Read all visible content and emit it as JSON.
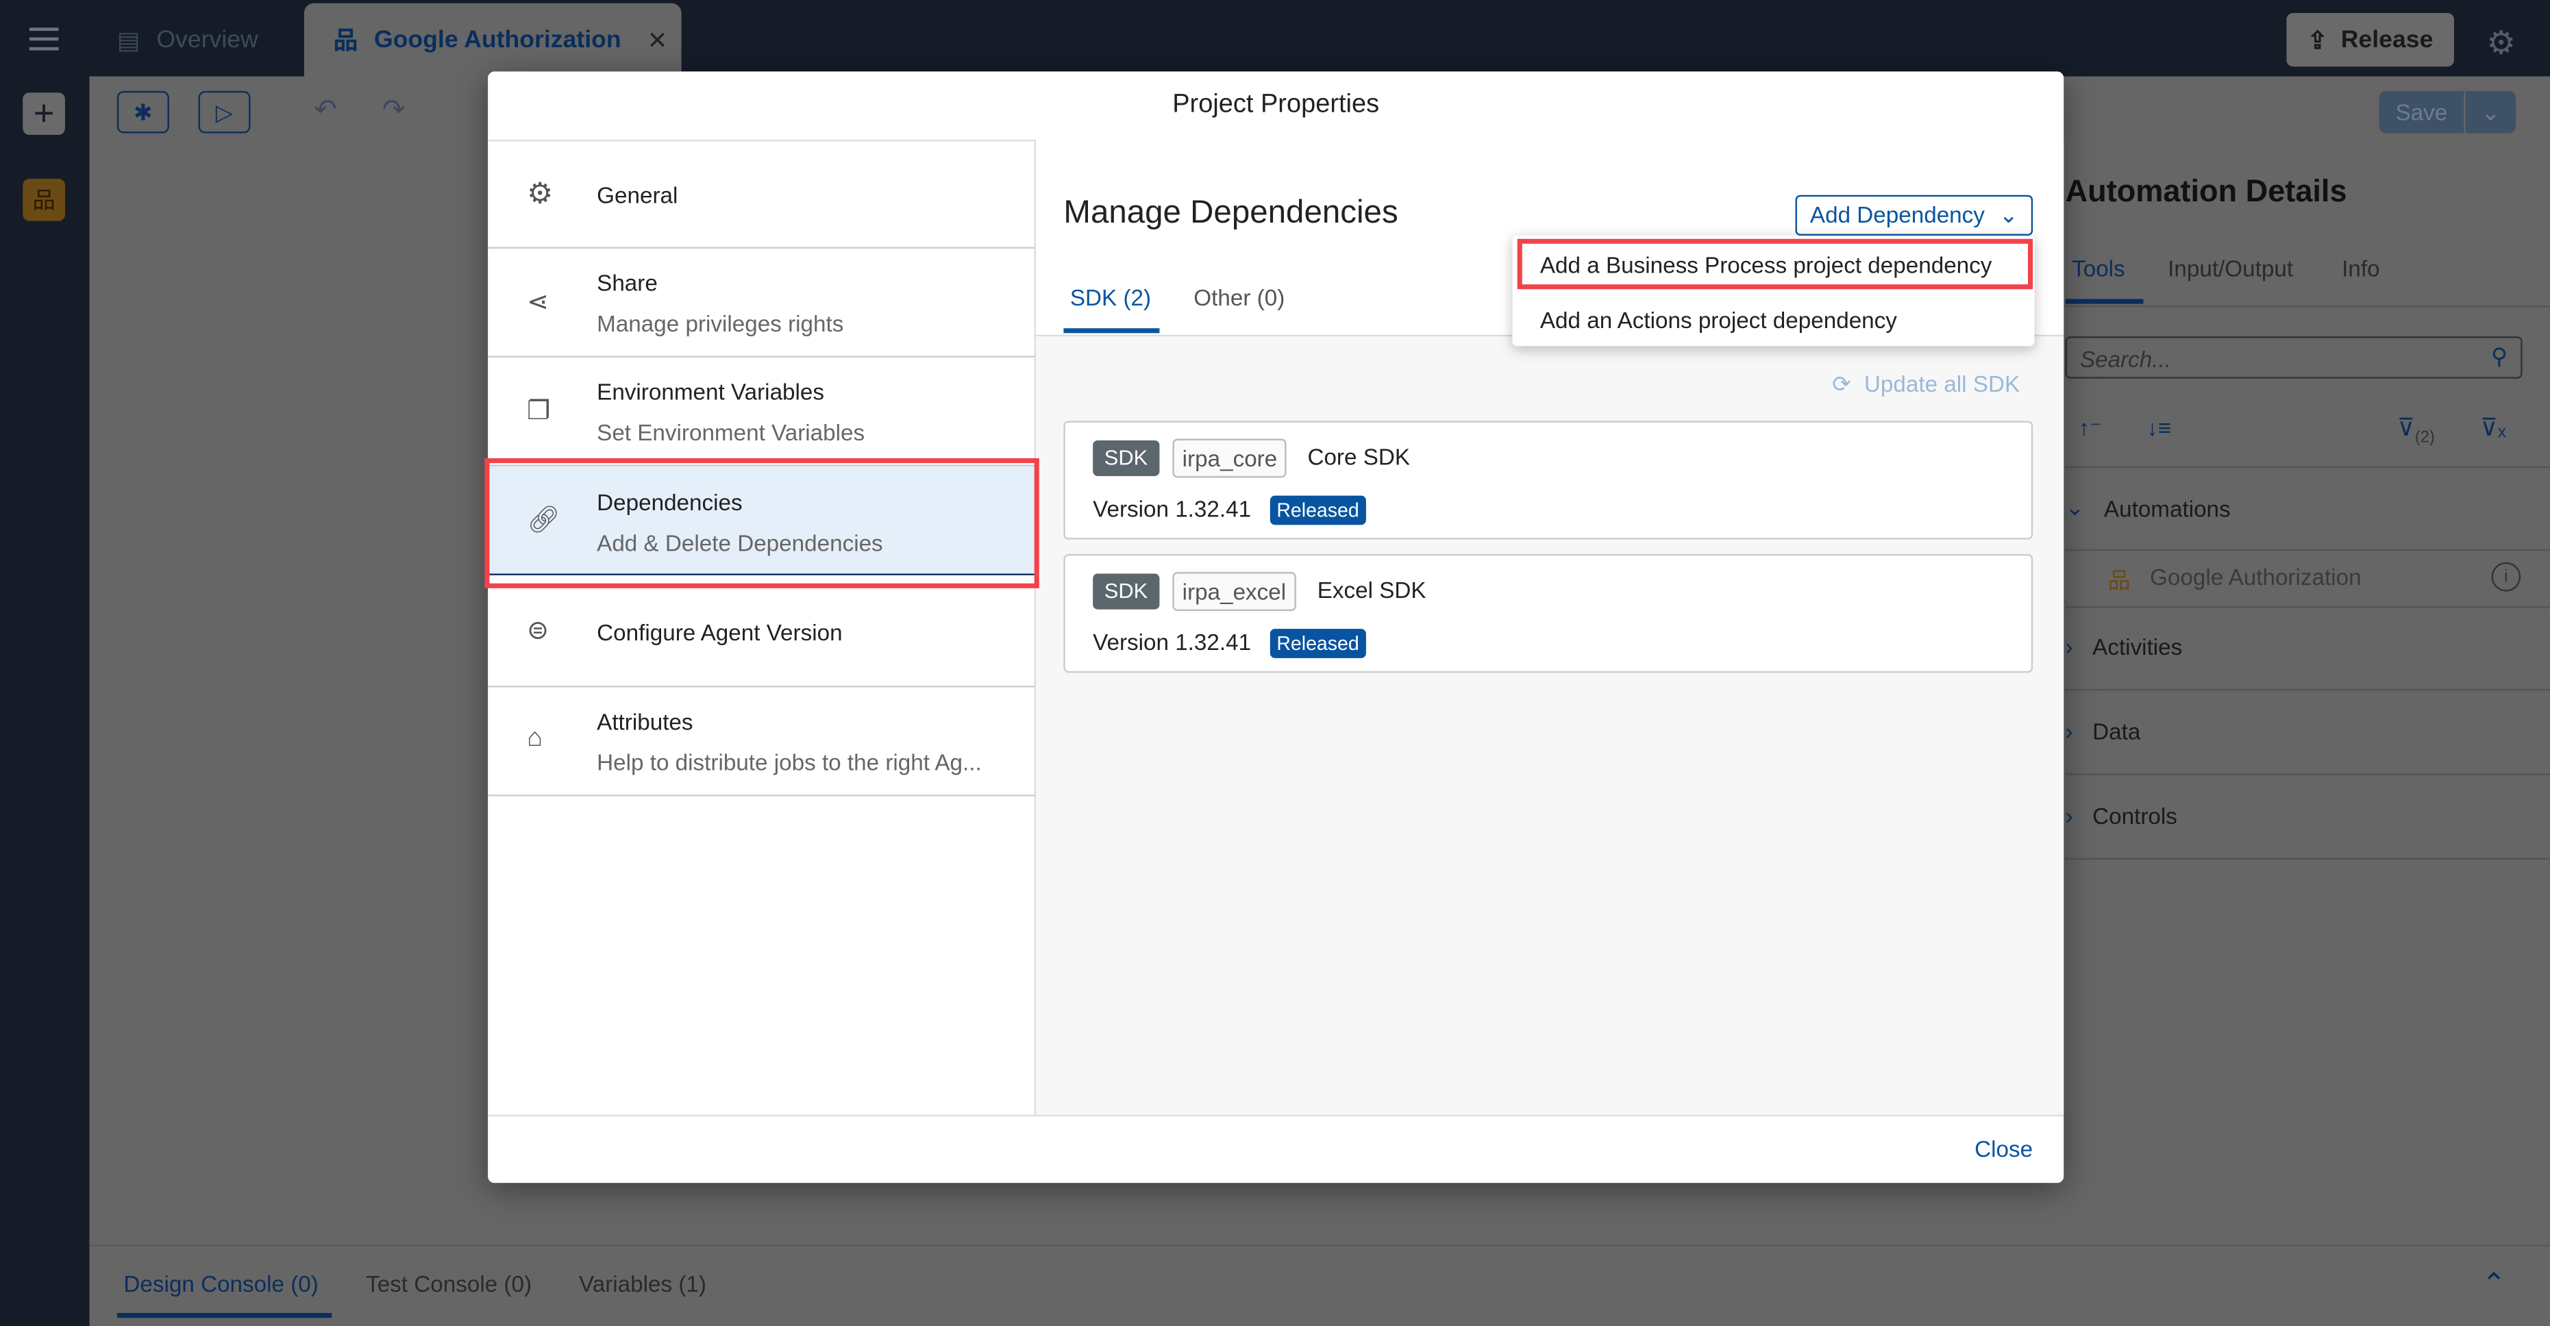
{
  "topbar": {
    "menu_icon": "hamburger-icon",
    "tabs": [
      {
        "label": "Overview",
        "icon": "clipboard-icon"
      },
      {
        "label": "Google Authorization",
        "icon": "process-icon",
        "closable": true
      }
    ],
    "release_label": "Release",
    "settings_icon": "gear-icon"
  },
  "toolbar": {
    "save_label": "Save"
  },
  "right_panel": {
    "title": "Automation Details",
    "tabs": [
      "Tools",
      "Input/Output",
      "Info"
    ],
    "active_tab": "Tools",
    "search_placeholder": "Search...",
    "filter_count": "(2)",
    "sections": [
      "Automations",
      "Activities",
      "Data",
      "Controls"
    ],
    "automation_item": "Google Authorization"
  },
  "bottom_tabs": [
    "Design Console (0)",
    "Test Console (0)",
    "Variables (1)"
  ],
  "dialog": {
    "title": "Project Properties",
    "nav": [
      {
        "title": "General",
        "subtitle": "",
        "icon": "gear-icon"
      },
      {
        "title": "Share",
        "subtitle": "Manage privileges rights",
        "icon": "share-icon"
      },
      {
        "title": "Environment Variables",
        "subtitle": "Set Environment Variables",
        "icon": "copy-icon"
      },
      {
        "title": "Dependencies",
        "subtitle": "Add & Delete Dependencies",
        "icon": "link-icon",
        "selected": true
      },
      {
        "title": "Configure Agent Version",
        "subtitle": "",
        "icon": "robot-icon"
      },
      {
        "title": "Attributes",
        "subtitle": "Help to distribute jobs to the right Ag...",
        "icon": "tag-icon"
      }
    ],
    "heading": "Manage Dependencies",
    "add_dependency_label": "Add Dependency",
    "dropdown": [
      "Add a Business Process project dependency",
      "Add an Actions project dependency"
    ],
    "tabs": [
      "SDK (2)",
      "Other (0)"
    ],
    "update_all_label": "Update all SDK",
    "dependencies": [
      {
        "type": "SDK",
        "code": "irpa_core",
        "name": "Core SDK",
        "version": "Version 1.32.41",
        "status": "Released"
      },
      {
        "type": "SDK",
        "code": "irpa_excel",
        "name": "Excel SDK",
        "version": "Version 1.32.41",
        "status": "Released"
      }
    ],
    "close_label": "Close"
  },
  "colors": {
    "accent": "#0854a0",
    "highlight": "#f2434a",
    "released": "#0854a0"
  }
}
